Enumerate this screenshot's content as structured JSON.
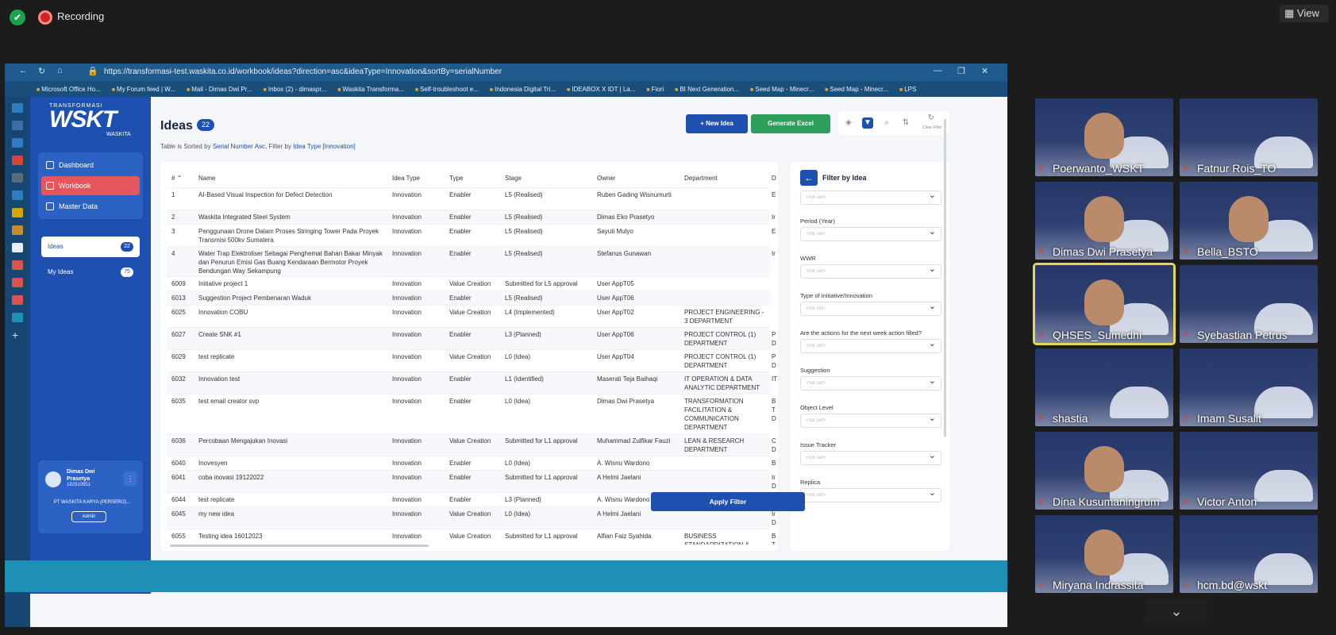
{
  "zoom": {
    "recording_label": "Recording",
    "view_label": "View"
  },
  "browser": {
    "url": "https://transformasi-test.waskita.co.id/workbook/ideas?direction=asc&ideaType=Innovation&sortBy=serialNumber",
    "bookmarks": [
      "Microsoft Office Ho...",
      "My Forum feed | W...",
      "Mail - Dimas Dwi Pr...",
      "Inbox (2) - dimaspr...",
      "Waskita Transforma...",
      "Self-troubleshoot e...",
      "Indonesia Digital Tri...",
      "IDEABOX X IDT | La...",
      "Fiori",
      "BI Next Generation...",
      "Seed Map - Minecr...",
      "Seed Map - Minecr...",
      "LPS"
    ]
  },
  "sidebar": {
    "logo_top": "TRANSFORMASI",
    "logo_main": "WSKT",
    "logo_sub": "WASKITA",
    "menu": [
      {
        "label": "Dashboard"
      },
      {
        "label": "Workbook"
      },
      {
        "label": "Master Data"
      }
    ],
    "ideas_label": "Ideas",
    "ideas_count": "22",
    "my_ideas_label": "My Ideas",
    "my_ideas_count": "75",
    "user": {
      "name": "Dimas Dwi Prasetya",
      "id": "182910951",
      "company": "PT WASKITA KARYA (PERSERO)...",
      "role": "Admin"
    },
    "collapse_glyph": "«"
  },
  "main": {
    "title": "Ideas",
    "count": "22",
    "sort_prefix": "Table is Sorted by ",
    "sort_by": "Serial Number Asc",
    "filter_prefix": ", Filter by ",
    "filter_by": "Idea Type [Innovation]",
    "new_idea": "+ New Idea",
    "generate_excel": "Generate Excel",
    "clear_filter": "Clear Filter"
  },
  "table": {
    "headers": [
      "#",
      "Name",
      "Idea Type",
      "Type",
      "Stage",
      "Owner",
      "Department",
      "D"
    ],
    "rows": [
      {
        "no": "1",
        "name": "AI-Based Visual Inspection for Defect Detection",
        "idea_type": "Innovation",
        "type": "Enabler",
        "stage": "L5 (Realised)",
        "owner": "Ruben Gading Wisnumurti",
        "dept": "",
        "d": "E"
      },
      {
        "no": "2",
        "name": "Waskita Integrated Steel System",
        "idea_type": "Innovation",
        "type": "Enabler",
        "stage": "L5 (Realised)",
        "owner": "Dimas Eko Prasetyo",
        "dept": "",
        "d": "Ir"
      },
      {
        "no": "3",
        "name": "Penggunaan Drone Dalam Proses Stringing Tower Pada Proyek Transmisi 500kv Sumatera",
        "idea_type": "Innovation",
        "type": "Enabler",
        "stage": "L5 (Realised)",
        "owner": "Sayuti Mulyo",
        "dept": "",
        "d": "E"
      },
      {
        "no": "4",
        "name": "Water Trap Elektroliser Sebagai Penghemat Bahan Bakar Minyak dan Penurun Emisi Gas Buang Kendaraan Bermotor Proyek Bendungan Way Sekampung",
        "idea_type": "Innovation",
        "type": "Enabler",
        "stage": "L5 (Realised)",
        "owner": "Stefanus Gunawan",
        "dept": "",
        "d": "Ir"
      },
      {
        "no": "6009",
        "name": "Initiative project 1",
        "idea_type": "Innovation",
        "type": "Value Creation",
        "stage": "Submitted for L5 approval",
        "owner": "User AppT05",
        "dept": "",
        "d": ""
      },
      {
        "no": "6013",
        "name": "Suggestion Project Pembenaran Waduk",
        "idea_type": "Innovation",
        "type": "Enabler",
        "stage": "L5 (Realised)",
        "owner": "User AppT06",
        "dept": "",
        "d": ""
      },
      {
        "no": "6025",
        "name": "Innovation COBU",
        "idea_type": "Innovation",
        "type": "Value Creation",
        "stage": "L4 (Implemented)",
        "owner": "User AppT02",
        "dept": "PROJECT ENGINEERING - 3 DEPARTMENT",
        "d": ""
      },
      {
        "no": "6027",
        "name": "Create SNK #1",
        "idea_type": "Innovation",
        "type": "Enabler",
        "stage": "L3 (Planned)",
        "owner": "User AppT06",
        "dept": "PROJECT CONTROL (1) DEPARTMENT",
        "d": "P D"
      },
      {
        "no": "6029",
        "name": "test replicate",
        "idea_type": "Innovation",
        "type": "Value Creation",
        "stage": "L0 (Idea)",
        "owner": "User AppT04",
        "dept": "PROJECT CONTROL (1) DEPARTMENT",
        "d": "P D"
      },
      {
        "no": "6032",
        "name": "Innovation test",
        "idea_type": "Innovation",
        "type": "Enabler",
        "stage": "L1 (Identified)",
        "owner": "Maserati Teja Baihaqi",
        "dept": "IT OPERATION & DATA ANALYTIC DEPARTMENT",
        "d": "IT"
      },
      {
        "no": "6035",
        "name": "test email creator svp",
        "idea_type": "Innovation",
        "type": "Enabler",
        "stage": "L0 (Idea)",
        "owner": "Dimas Dwi Prasetya",
        "dept": "TRANSFORMATION FACILITATION & COMMUNICATION DEPARTMENT",
        "d": "B T D"
      },
      {
        "no": "6036",
        "name": "Percobaan Mengajukan Inovasi",
        "idea_type": "Innovation",
        "type": "Value Creation",
        "stage": "Submitted for L1 approval",
        "owner": "Muhammad Zulfikar Fauzi",
        "dept": "LEAN & RESEARCH DEPARTMENT",
        "d": "C D"
      },
      {
        "no": "6040",
        "name": "Inovesyen",
        "idea_type": "Innovation",
        "type": "Enabler",
        "stage": "L0 (Idea)",
        "owner": "A. Wisnu Wardono",
        "dept": "",
        "d": "B"
      },
      {
        "no": "6041",
        "name": "coba inovasi 19122022",
        "idea_type": "Innovation",
        "type": "Enabler",
        "stage": "Submitted for L1 approval",
        "owner": "A Helmi Jaelani",
        "dept": "",
        "d": "Ir D"
      },
      {
        "no": "6044",
        "name": "test replicate",
        "idea_type": "Innovation",
        "type": "Enabler",
        "stage": "L3 (Planned)",
        "owner": "A. Wisnu Wardono",
        "dept": "",
        "d": "B"
      },
      {
        "no": "6045",
        "name": "my new idea",
        "idea_type": "Innovation",
        "type": "Value Creation",
        "stage": "L0 (Idea)",
        "owner": "A Helmi Jaelani",
        "dept": "",
        "d": "Ir D"
      },
      {
        "no": "6055",
        "name": "Testing idea 16012023",
        "idea_type": "Innovation",
        "type": "Value Creation",
        "stage": "Submitted for L1 approval",
        "owner": "Alfian Faiz Syahida",
        "dept": "BUSINESS STANDARDIZATION &",
        "d": "B T"
      }
    ]
  },
  "filter": {
    "title": "Filter by Idea",
    "placeholder": "<not set>",
    "fields": [
      "Period (Year)",
      "WWR",
      "Type of Initiative/Innovation",
      "Are the actions for the next week action filled?",
      "Suggestion",
      "Object Level",
      "Issue Tracker",
      "Replica"
    ],
    "apply": "Apply Filter"
  },
  "participants": [
    "Poerwanto_WSKT",
    "Fatnur Rois_TO",
    "Dimas Dwi Prasetya",
    "Bella_BSTO",
    "QHSES_Sumedhi",
    "Syebastian Petrus",
    "shastia",
    "Imam Susalit",
    "Dina Kusumaningrum",
    "Victor Anton",
    "Miryana Indrassita",
    "hcm.bd@wskt"
  ],
  "colors": {
    "brand_blue": "#1e50b0",
    "accent_red": "#e5575d",
    "excel_green": "#2e9e5b",
    "speaker_outline": "#e6d84e"
  }
}
